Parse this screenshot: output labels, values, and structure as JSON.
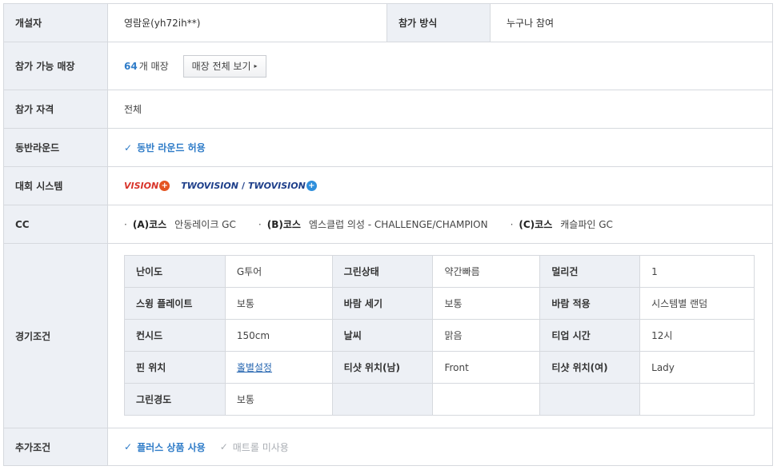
{
  "founder": {
    "label": "개설자",
    "value": "영람윤(yh72ih**)"
  },
  "join_method": {
    "label": "참가 방식",
    "value": "누구나 참여"
  },
  "stores": {
    "label": "참가 가능 매장",
    "count": "64",
    "count_suffix": "개 매장",
    "button": "매장 전체 보기",
    "button_arrow": "▸"
  },
  "eligibility": {
    "label": "참가 자격",
    "value": "전체"
  },
  "companion": {
    "label": "동반라운드",
    "check": "✓",
    "value": "동반 라운드 허용"
  },
  "system": {
    "label": "대회 시스템",
    "logo1": "VISION",
    "logo2a": "TWOVISION",
    "slash": "/",
    "logo2b": "TWOVISION",
    "plus": "+"
  },
  "cc": {
    "label": "CC",
    "items": [
      {
        "bullet": "·",
        "code": "(A)코스",
        "name": "안동레이크 GC"
      },
      {
        "bullet": "·",
        "code": "(B)코스",
        "name": "엠스클럽 의성 - CHALLENGE/CHAMPION"
      },
      {
        "bullet": "·",
        "code": "(C)코스",
        "name": "캐슬파인 GC"
      }
    ]
  },
  "conditions": {
    "label": "경기조건",
    "rows": [
      [
        {
          "k": "난이도"
        },
        {
          "v": "G투어"
        },
        {
          "k": "그린상태"
        },
        {
          "v": "약간빠름"
        },
        {
          "k": "멀리건"
        },
        {
          "v": "1"
        }
      ],
      [
        {
          "k": "스윙 플레이트"
        },
        {
          "v": "보통"
        },
        {
          "k": "바람 세기"
        },
        {
          "v": "보통"
        },
        {
          "k": "바람 적용"
        },
        {
          "v": "시스템별 랜덤"
        }
      ],
      [
        {
          "k": "컨시드"
        },
        {
          "v": "150cm"
        },
        {
          "k": "날씨"
        },
        {
          "v": "맑음"
        },
        {
          "k": "티업 시간"
        },
        {
          "v": "12시"
        }
      ],
      [
        {
          "k": "핀 위치"
        },
        {
          "v": "홀별설정"
        },
        {
          "k": "티샷 위치(남)"
        },
        {
          "v": "Front"
        },
        {
          "k": "티샷 위치(여)"
        },
        {
          "v": "Lady"
        }
      ],
      [
        {
          "k": "그린경도"
        },
        {
          "v": "보통"
        },
        {
          "k": ""
        },
        {
          "v": ""
        },
        {
          "k": ""
        },
        {
          "v": ""
        }
      ]
    ]
  },
  "extra": {
    "label": "추가조건",
    "check": "✓",
    "checked": "플러스 상품 사용",
    "unchecked": "매트롤 미사용"
  }
}
